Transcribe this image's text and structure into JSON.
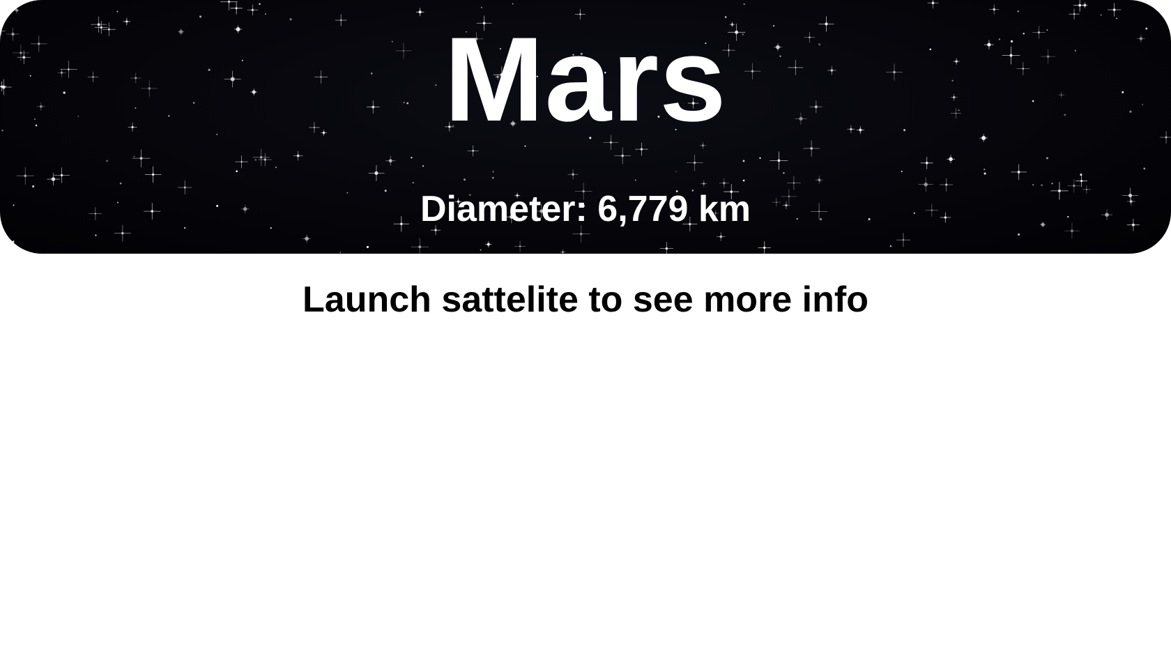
{
  "header": {
    "title": "Mars",
    "diameter_label": "Diameter: 6,779 km",
    "background_color": "#04040a"
  },
  "main": {
    "launch_message": "Launch sattelite to see more info"
  }
}
